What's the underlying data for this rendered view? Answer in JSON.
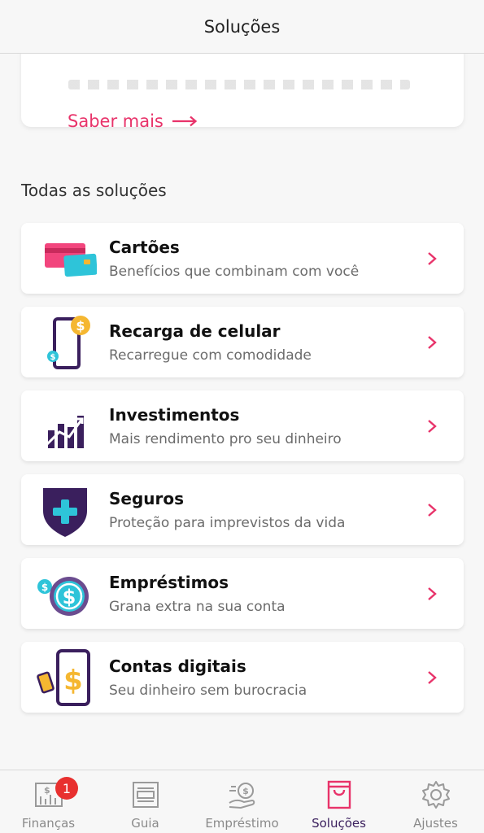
{
  "header": {
    "title": "Soluções"
  },
  "promo": {
    "link_label": "Saber mais"
  },
  "section": {
    "title": "Todas as soluções"
  },
  "solutions": [
    {
      "title": "Cartões",
      "subtitle": "Benefícios que combinam com você",
      "icon": "cards-icon"
    },
    {
      "title": "Recarga de celular",
      "subtitle": "Recarregue com comodidade",
      "icon": "phone-recharge-icon"
    },
    {
      "title": "Investimentos",
      "subtitle": "Mais rendimento pro seu dinheiro",
      "icon": "investment-chart-icon"
    },
    {
      "title": "Seguros",
      "subtitle": "Proteção para imprevistos da vida",
      "icon": "shield-icon"
    },
    {
      "title": "Empréstimos",
      "subtitle": "Grana extra na sua conta",
      "icon": "coins-icon"
    },
    {
      "title": "Contas digitais",
      "subtitle": "Seu dinheiro sem burocracia",
      "icon": "digital-account-icon"
    }
  ],
  "nav": {
    "items": [
      {
        "label": "Finanças",
        "icon": "finance-chart-icon",
        "badge": "1"
      },
      {
        "label": "Guia",
        "icon": "guide-icon"
      },
      {
        "label": "Empréstimo",
        "icon": "loan-hand-icon"
      },
      {
        "label": "Soluções",
        "icon": "shopping-bag-icon",
        "active": true
      },
      {
        "label": "Ajustes",
        "icon": "gear-icon"
      }
    ]
  },
  "colors": {
    "accent": "#e8336a",
    "purple": "#3a1f5d",
    "gold": "#f5b731",
    "cyan": "#2ec4d9",
    "background": "#f7f7f7"
  }
}
